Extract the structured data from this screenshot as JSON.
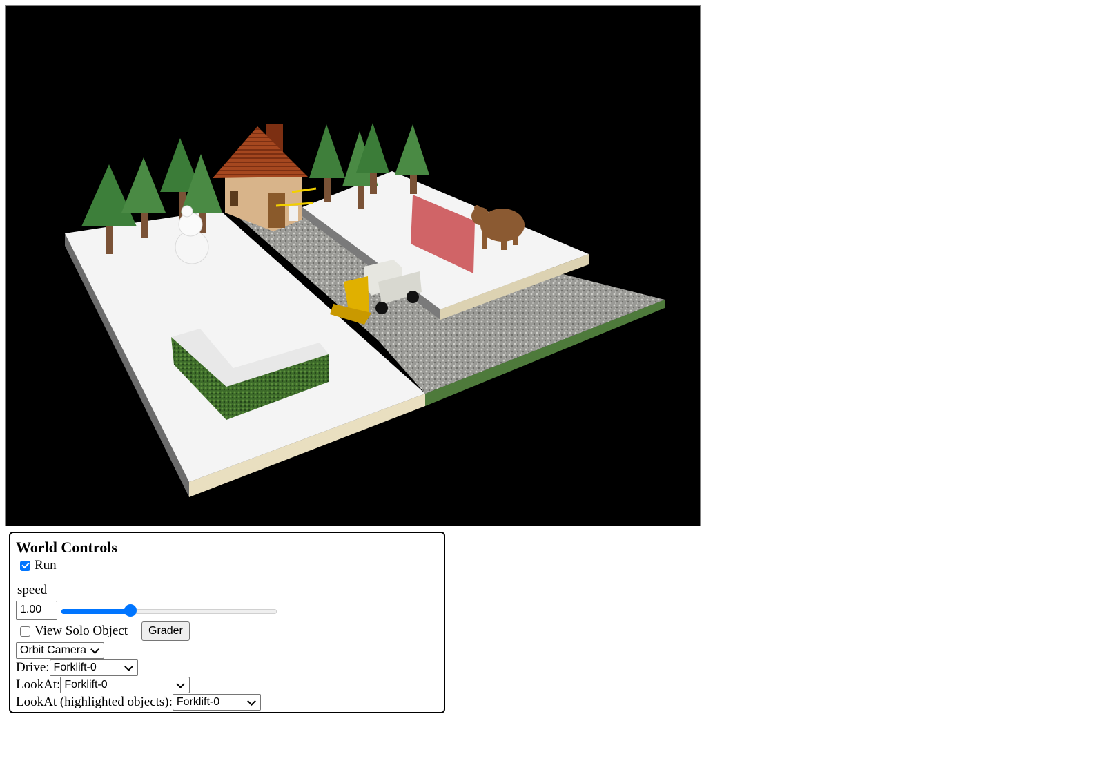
{
  "world_controls": {
    "title": "World Controls",
    "run_label": "Run",
    "run_checked": true,
    "speed_label": "speed",
    "speed_value": "1.00",
    "speed_slider_fraction": 0.32,
    "solo_label": "View Solo Object",
    "solo_checked": false,
    "grader_label": "Grader",
    "camera_select": "Orbit Camera",
    "drive_label": "Drive:",
    "drive_value": "Forklift-0",
    "lookat_label": "LookAt:",
    "lookat_value": "Forklift-0",
    "lookat_highlight_label": "LookAt (highlighted objects):",
    "lookat_highlight_value": "Forklift-0"
  },
  "colors": {
    "accent": "#0075ff",
    "viewport_background": "#000000"
  }
}
